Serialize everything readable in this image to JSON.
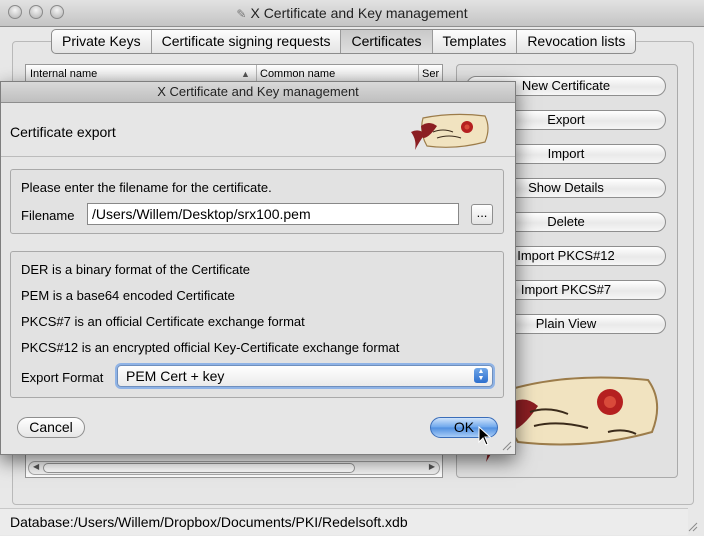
{
  "window": {
    "title": "X Certificate and Key management",
    "doc_icon": "✎"
  },
  "tabs": [
    {
      "label": "Private Keys",
      "selected": false
    },
    {
      "label": "Certificate signing requests",
      "selected": false
    },
    {
      "label": "Certificates",
      "selected": true
    },
    {
      "label": "Templates",
      "selected": false
    },
    {
      "label": "Revocation lists",
      "selected": false
    }
  ],
  "list": {
    "columns": [
      "Internal name",
      "Common name",
      "Ser"
    ],
    "sort_indicator": "▲"
  },
  "side_buttons": [
    "New Certificate",
    "Export",
    "Import",
    "Show Details",
    "Delete",
    "Import PKCS#12",
    "Import PKCS#7",
    "Plain View"
  ],
  "status_bar": {
    "text": "Database:/Users/Willem/Dropbox/Documents/PKI/Redelsoft.xdb"
  },
  "dialog": {
    "title": "X Certificate and Key management",
    "heading": "Certificate export",
    "filename_prompt": "Please enter the filename for the certificate.",
    "filename_label": "Filename",
    "filename_value": "/Users/Willem/Desktop/srx100.pem",
    "browse_label": "...",
    "info_lines": [
      "DER is a binary format of the Certificate",
      "PEM is a base64 encoded Certificate",
      "PKCS#7 is an official Certificate exchange format",
      "PKCS#12 is an encrypted official Key-Certificate exchange format"
    ],
    "format_label": "Export Format",
    "format_selected": "PEM Cert + key",
    "cancel_label": "Cancel",
    "ok_label": "OK"
  },
  "colors": {
    "ok_button": "#4f8fe0",
    "logo_ribbon": "#8b1e22",
    "logo_paper": "#f1e3c0"
  },
  "icons": [
    "close-icon",
    "minimize-icon",
    "zoom-icon",
    "document-icon",
    "scroll-logo-icon",
    "resize-grip-icon",
    "mouse-pointer-icon"
  ]
}
